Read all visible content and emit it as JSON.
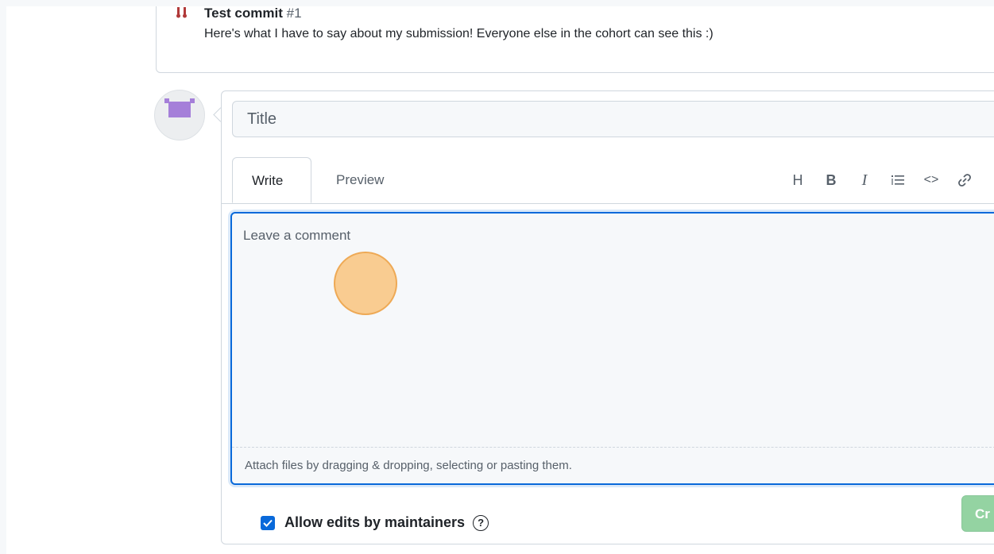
{
  "previous_comment": {
    "title": "Test commit",
    "number": "#1",
    "body": "Here's what I have to say about my submission! Everyone else in the cohort can see this :)"
  },
  "comment_form": {
    "title_placeholder": "Title",
    "tabs": [
      {
        "label": "Write",
        "active": true
      },
      {
        "label": "Preview",
        "active": false
      }
    ],
    "toolbar": [
      {
        "icon": "heading-icon",
        "glyph": "H"
      },
      {
        "icon": "bold-icon",
        "glyph": "B"
      },
      {
        "icon": "italic-icon",
        "glyph": "I"
      },
      {
        "icon": "list-icon",
        "glyph": ""
      },
      {
        "icon": "code-icon",
        "glyph": "<>"
      },
      {
        "icon": "link-icon",
        "glyph": ""
      }
    ],
    "body_placeholder": "Leave a comment",
    "attach_hint": "Attach files by dragging & dropping, selecting or pasting them.",
    "allow_edits_label": "Allow edits by maintainers",
    "allow_edits_checked": true,
    "help_glyph": "?",
    "submit_label": "Cr"
  },
  "colors": {
    "accent": "#0969da",
    "submit_disabled": "#94d3a2",
    "avatar": "#a57fd9"
  }
}
